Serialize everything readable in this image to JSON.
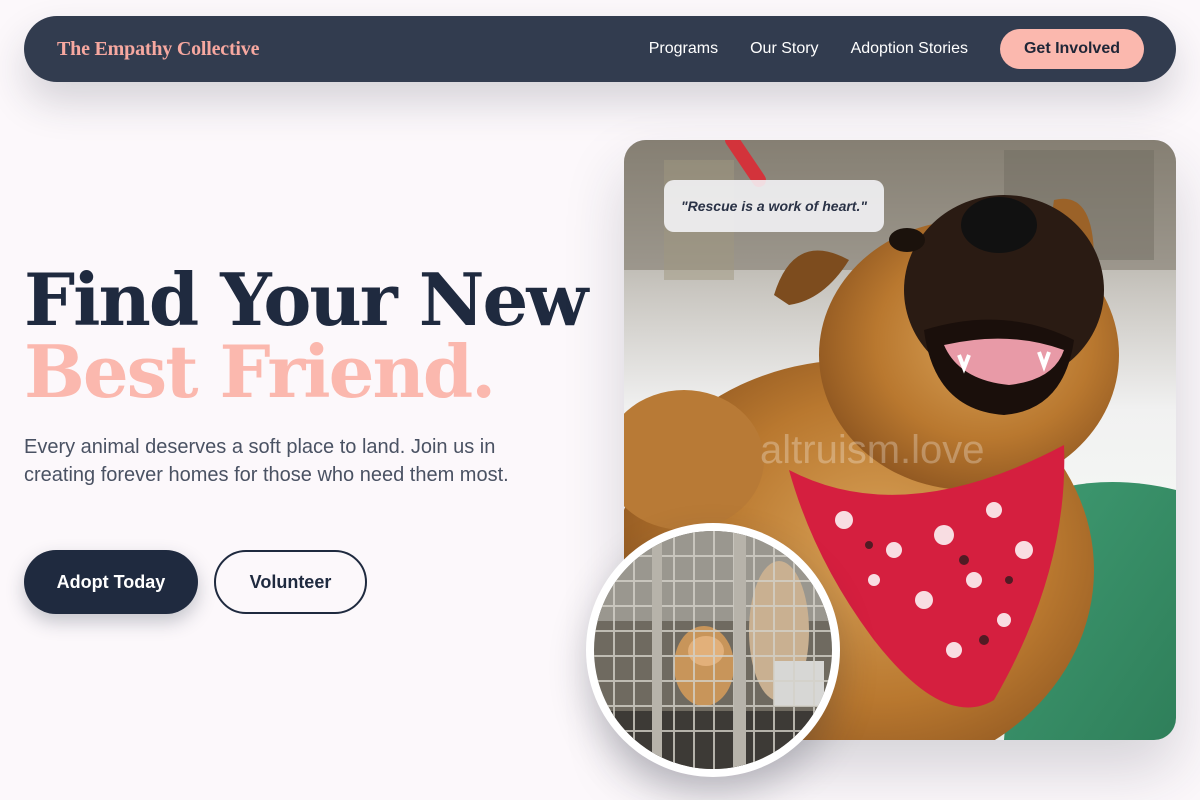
{
  "nav": {
    "brand": "The Empathy Collective",
    "links": [
      "Programs",
      "Our Story",
      "Adoption Stories"
    ],
    "cta": "Get Involved"
  },
  "hero": {
    "title_line1": "Find Your New",
    "title_line2": "Best Friend.",
    "subtitle": "Every animal deserves a soft place to land. Join us in creating forever homes for those who need them most.",
    "primary_button": "Adopt Today",
    "secondary_button": "Volunteer"
  },
  "image": {
    "quote": "\"Rescue is a work of heart.\"",
    "watermark": "altruism.love",
    "main_photo": "happy dog with red bandana",
    "inset_photo": "dogs in shelter kennel"
  },
  "colors": {
    "navy": "#1f2a3f",
    "nav_bg": "#323c4f",
    "accent_pink": "#fbb8ae",
    "page_bg": "#fcf8fb"
  }
}
